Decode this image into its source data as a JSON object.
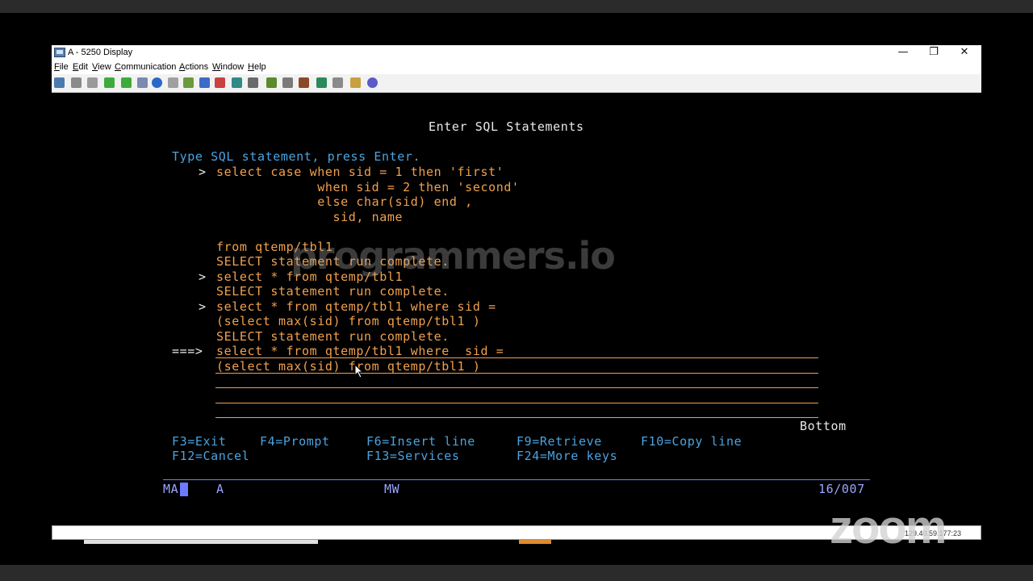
{
  "window": {
    "title": "A - 5250 Display",
    "controls": {
      "minimize": "—",
      "restore": "❐",
      "close": "✕"
    }
  },
  "menu": [
    {
      "mn": "F",
      "rest": "ile"
    },
    {
      "mn": "E",
      "rest": "dit"
    },
    {
      "mn": "V",
      "rest": "iew"
    },
    {
      "mn": "C",
      "rest": "ommunication"
    },
    {
      "mn": "A",
      "rest": "ctions"
    },
    {
      "mn": "W",
      "rest": "indow"
    },
    {
      "mn": "H",
      "rest": "elp"
    }
  ],
  "toolbar_icons": [
    "print-icon",
    "copy-icon",
    "paste-icon",
    "send-file-icon",
    "receive-file-icon",
    "macro-icon",
    "keypad-icon",
    "compass-icon",
    "keyboard-map-icon",
    "color-map-icon",
    "popup-keypad-icon",
    "record-icon",
    "play-icon",
    "display-icon",
    "grid-icon",
    "customize-icon",
    "toolbar-icon",
    "settings-icon",
    "transfer-icon",
    "tools-icon",
    "notes-icon",
    "help-icon"
  ],
  "screen": {
    "title": "Enter SQL Statements",
    "instruction": "Type SQL statement, press Enter.",
    "history_lines": [
      {
        "prefix": ">",
        "text": "select case when sid = 1 then 'first'",
        "color": "o"
      },
      {
        "prefix": "",
        "text": "             when sid = 2 then 'second'",
        "color": "o"
      },
      {
        "prefix": "",
        "text": "             else char(sid) end ,",
        "color": "o"
      },
      {
        "prefix": "",
        "text": "               sid, name",
        "color": "o"
      },
      {
        "prefix": "",
        "text": "",
        "color": "o"
      },
      {
        "prefix": "",
        "text": "from qtemp/tbl1",
        "color": "o"
      },
      {
        "prefix": "",
        "text": "SELECT statement run complete.",
        "color": "o"
      },
      {
        "prefix": ">",
        "text": "select * from qtemp/tbl1",
        "color": "o"
      },
      {
        "prefix": "",
        "text": "SELECT statement run complete.",
        "color": "o"
      },
      {
        "prefix": ">",
        "text": "select * from qtemp/tbl1 where sid =",
        "color": "o"
      },
      {
        "prefix": "",
        "text": "(select max(sid) from qtemp/tbl1 )",
        "color": "o"
      },
      {
        "prefix": "",
        "text": "SELECT statement run complete.",
        "color": "o"
      }
    ],
    "prompt_arrow": "===>",
    "input_lines": [
      "select * from qtemp/tbl1 where  sid =",
      "(select max(sid) from qtemp/tbl1 )",
      "",
      "",
      ""
    ],
    "bottom_indicator": "Bottom",
    "fkeys_row1": [
      {
        "label": "F3=Exit"
      },
      {
        "label": "F4=Prompt"
      },
      {
        "label": "F6=Insert line"
      },
      {
        "label": "F9=Retrieve"
      },
      {
        "label": "F10=Copy line"
      }
    ],
    "fkeys_row2": [
      {
        "label": "F12=Cancel"
      },
      {
        "label": "F13=Services"
      },
      {
        "label": "F24=More keys"
      }
    ]
  },
  "status": {
    "session": "MA",
    "session_suffix": "A",
    "mode": "MW",
    "position": "16/007"
  },
  "overlay": {
    "watermark": "programmers.io",
    "zoom": "zoom",
    "ip": "129.40.59.177:23"
  }
}
